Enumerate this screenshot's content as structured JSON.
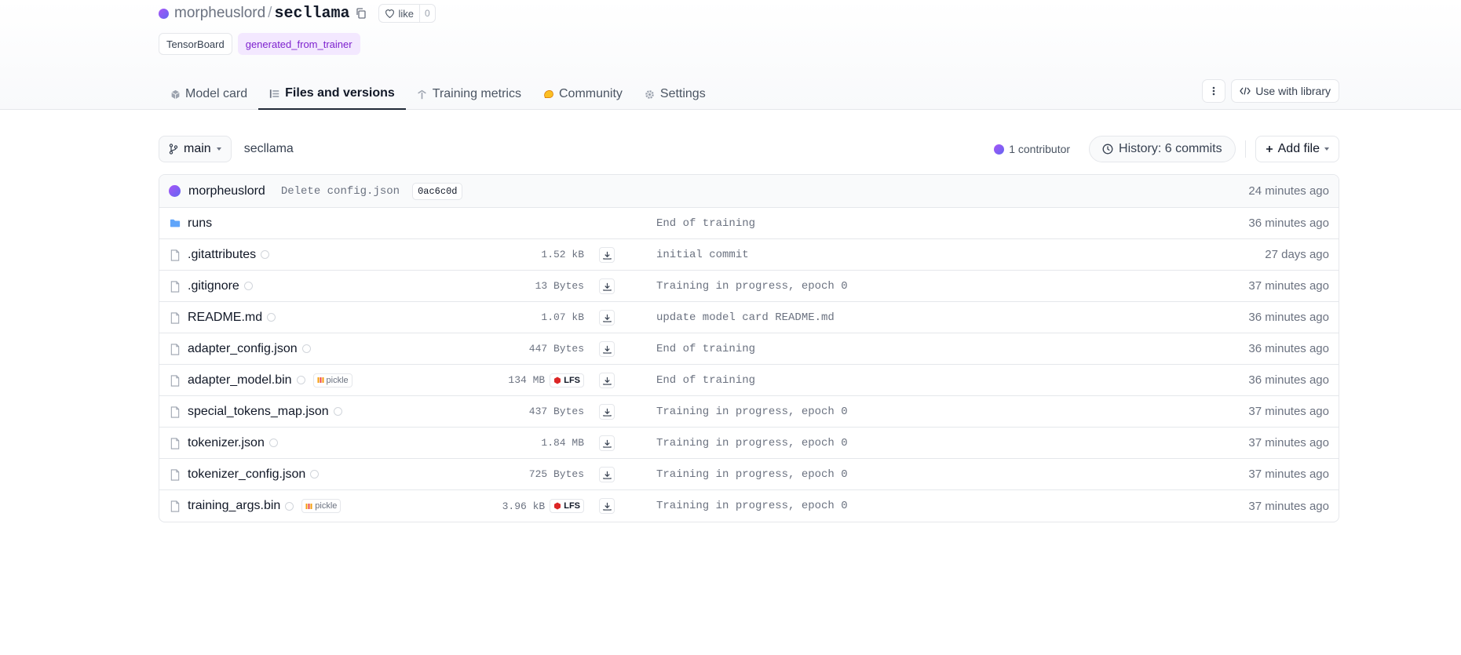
{
  "repo": {
    "owner": "morpheuslord",
    "separator": "/",
    "name": "secllama",
    "like_label": "like",
    "like_count": "0"
  },
  "tags": [
    "TensorBoard",
    "generated_from_trainer"
  ],
  "tabs": [
    {
      "label": "Model card",
      "icon": "cube-icon"
    },
    {
      "label": "Files and versions",
      "icon": "files-icon"
    },
    {
      "label": "Training metrics",
      "icon": "metrics-icon"
    },
    {
      "label": "Community",
      "icon": "community-icon"
    },
    {
      "label": "Settings",
      "icon": "gear-icon"
    }
  ],
  "header_actions": {
    "use_with_library": "Use with library"
  },
  "toolbar": {
    "branch": "main",
    "path": "secllama",
    "contributors": "1 contributor",
    "history": "History: 6 commits",
    "add_file": "Add file"
  },
  "last_commit": {
    "author": "morpheuslord",
    "message": "Delete config.json",
    "hash": "0ac6c0d",
    "time": "24 minutes ago"
  },
  "files": [
    {
      "name": "runs",
      "type": "folder",
      "size": "",
      "lfs": false,
      "pickle": false,
      "commit": "End of training",
      "time": "36 minutes ago"
    },
    {
      "name": ".gitattributes",
      "type": "file",
      "size": "1.52 kB",
      "lfs": false,
      "pickle": false,
      "commit": "initial commit",
      "time": "27 days ago"
    },
    {
      "name": ".gitignore",
      "type": "file",
      "size": "13 Bytes",
      "lfs": false,
      "pickle": false,
      "commit": "Training in progress, epoch 0",
      "time": "37 minutes ago"
    },
    {
      "name": "README.md",
      "type": "file",
      "size": "1.07 kB",
      "lfs": false,
      "pickle": false,
      "commit": "update model card README.md",
      "time": "36 minutes ago"
    },
    {
      "name": "adapter_config.json",
      "type": "file",
      "size": "447 Bytes",
      "lfs": false,
      "pickle": false,
      "commit": "End of training",
      "time": "36 minutes ago"
    },
    {
      "name": "adapter_model.bin",
      "type": "file",
      "size": "134 MB",
      "lfs": true,
      "pickle": true,
      "commit": "End of training",
      "time": "36 minutes ago"
    },
    {
      "name": "special_tokens_map.json",
      "type": "file",
      "size": "437 Bytes",
      "lfs": false,
      "pickle": false,
      "commit": "Training in progress, epoch 0",
      "time": "37 minutes ago"
    },
    {
      "name": "tokenizer.json",
      "type": "file",
      "size": "1.84 MB",
      "lfs": false,
      "pickle": false,
      "commit": "Training in progress, epoch 0",
      "time": "37 minutes ago"
    },
    {
      "name": "tokenizer_config.json",
      "type": "file",
      "size": "725 Bytes",
      "lfs": false,
      "pickle": false,
      "commit": "Training in progress, epoch 0",
      "time": "37 minutes ago"
    },
    {
      "name": "training_args.bin",
      "type": "file",
      "size": "3.96 kB",
      "lfs": true,
      "pickle": true,
      "commit": "Training in progress, epoch 0",
      "time": "37 minutes ago"
    }
  ],
  "labels": {
    "lfs": "LFS",
    "pickle": "pickle"
  },
  "colors": {
    "avatar_start": "#a855f7",
    "avatar_end": "#6366f1",
    "tag_purple_bg": "#f3e8ff",
    "tag_purple_text": "#7e22ce",
    "folder": "#60a5fa",
    "lfs_red": "#dc2626",
    "community_yellow": "#fbbf24"
  }
}
